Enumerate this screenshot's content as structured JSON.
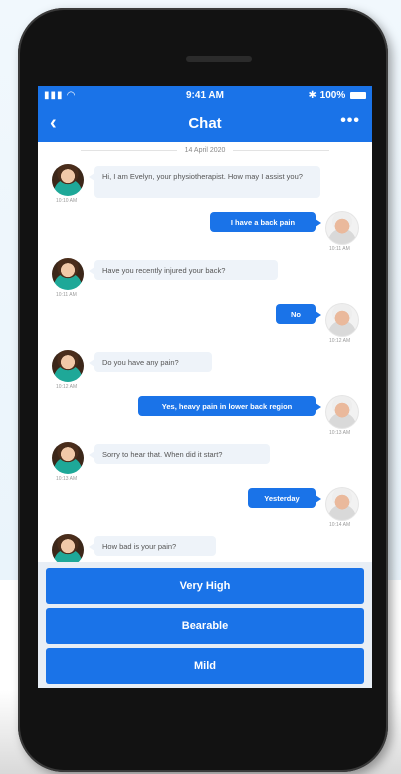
{
  "status_bar": {
    "signal": "▮▮▮ ◠",
    "time": "9:41 AM",
    "battery": "✱ 100%"
  },
  "nav": {
    "back": "‹",
    "title": "Chat",
    "more": "•••"
  },
  "date_separator": "14 April 2020",
  "messages": [
    {
      "sender": "therapist",
      "text": "Hi, I am Evelyn, your physiotherapist. How may I assist you?",
      "time": "10:10 AM"
    },
    {
      "sender": "patient",
      "text": "I have a back pain",
      "time": "10:11 AM"
    },
    {
      "sender": "therapist",
      "text": "Have you recently injured your back?",
      "time": "10:11 AM"
    },
    {
      "sender": "patient",
      "text": "No",
      "time": "10:12 AM"
    },
    {
      "sender": "therapist",
      "text": "Do you have any pain?",
      "time": "10:12 AM"
    },
    {
      "sender": "patient",
      "text": "Yes, heavy pain in lower back region",
      "time": "10:13 AM"
    },
    {
      "sender": "therapist",
      "text": "Sorry to hear that. When did it start?",
      "time": "10:13 AM"
    },
    {
      "sender": "patient",
      "text": "Yesterday",
      "time": "10:14 AM"
    },
    {
      "sender": "therapist",
      "text": "How bad is your pain?",
      "time": ""
    }
  ],
  "options": [
    "Very High",
    "Bearable",
    "Mild"
  ],
  "colors": {
    "accent": "#1a73e8",
    "incoming_bubble": "#eef3f9"
  }
}
